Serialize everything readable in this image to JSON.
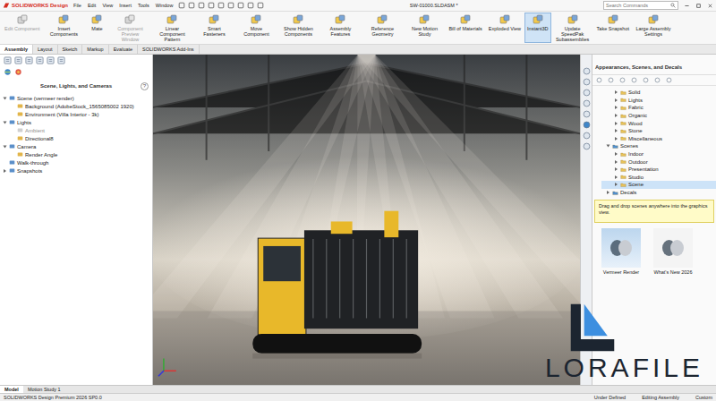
{
  "title_bar": {
    "logo": "SOLIDWORKS Design",
    "menus": [
      "File",
      "Edit",
      "View",
      "Insert",
      "Tools",
      "Window"
    ],
    "document": "SW-01000.SLDASM *",
    "search_placeholder": "Search Commands"
  },
  "ribbon": [
    {
      "label": "Edit Component",
      "disabled": true,
      "selected": false
    },
    {
      "label": "Insert Components",
      "disabled": false,
      "selected": false
    },
    {
      "label": "Mate",
      "disabled": false,
      "selected": false
    },
    {
      "label": "Component Preview Window",
      "disabled": true,
      "selected": false
    },
    {
      "label": "Linear Component Pattern",
      "disabled": false,
      "selected": false
    },
    {
      "label": "Smart Fasteners",
      "disabled": false,
      "selected": false
    },
    {
      "label": "Move Component",
      "disabled": false,
      "selected": false
    },
    {
      "label": "Show Hidden Components",
      "disabled": false,
      "selected": false
    },
    {
      "label": "Assembly Features",
      "disabled": false,
      "selected": false
    },
    {
      "label": "Reference Geometry",
      "disabled": false,
      "selected": false
    },
    {
      "label": "New Motion Study",
      "disabled": false,
      "selected": false
    },
    {
      "label": "Bill of Materials",
      "disabled": false,
      "selected": false
    },
    {
      "label": "Exploded View",
      "disabled": false,
      "selected": false
    },
    {
      "label": "Instant3D",
      "disabled": false,
      "selected": true
    },
    {
      "label": "Update SpeedPak Subassemblies",
      "disabled": false,
      "selected": false
    },
    {
      "label": "Take Snapshot",
      "disabled": false,
      "selected": false
    },
    {
      "label": "Large Assembly Settings",
      "disabled": false,
      "selected": false
    }
  ],
  "command_tabs": [
    {
      "label": "Assembly",
      "selected": true
    },
    {
      "label": "Layout",
      "selected": false
    },
    {
      "label": "Sketch",
      "selected": false
    },
    {
      "label": "Markup",
      "selected": false
    },
    {
      "label": "Evaluate",
      "selected": false
    },
    {
      "label": "SOLIDWORKS Add-Ins",
      "selected": false
    }
  ],
  "left_panel": {
    "title": "Scene, Lights, and Cameras",
    "help": "?",
    "tree": [
      {
        "label": "Scene (vermeer render)",
        "depth": 0,
        "leaf": false,
        "expanded": true,
        "disabled": false
      },
      {
        "label": "Background (AdobeStock_1565085002 1920)",
        "depth": 1,
        "leaf": true,
        "expanded": false,
        "disabled": false
      },
      {
        "label": "Environment (Villa Interior - 3k)",
        "depth": 1,
        "leaf": true,
        "expanded": false,
        "disabled": false
      },
      {
        "label": "Lights",
        "depth": 0,
        "leaf": false,
        "expanded": true,
        "disabled": false
      },
      {
        "label": "Ambient",
        "depth": 1,
        "leaf": true,
        "expanded": false,
        "disabled": true
      },
      {
        "label": "Directional8",
        "depth": 1,
        "leaf": true,
        "expanded": false,
        "disabled": false
      },
      {
        "label": "Camera",
        "depth": 0,
        "leaf": false,
        "expanded": true,
        "disabled": false
      },
      {
        "label": "Render Angle",
        "depth": 1,
        "leaf": true,
        "expanded": false,
        "disabled": false
      },
      {
        "label": "Walk-through",
        "depth": 0,
        "leaf": true,
        "expanded": false,
        "disabled": false
      },
      {
        "label": "Snapshots",
        "depth": 0,
        "leaf": false,
        "expanded": false,
        "disabled": false
      }
    ]
  },
  "right_panel": {
    "title": "Appearances, Scenes, and Decals",
    "tree": [
      {
        "label": "Solid",
        "depth": 1,
        "expanded": false,
        "selected": false
      },
      {
        "label": "Lights",
        "depth": 1,
        "expanded": false,
        "selected": false
      },
      {
        "label": "Fabric",
        "depth": 1,
        "expanded": false,
        "selected": false
      },
      {
        "label": "Organic",
        "depth": 1,
        "expanded": false,
        "selected": false
      },
      {
        "label": "Wood",
        "depth": 1,
        "expanded": false,
        "selected": false
      },
      {
        "label": "Stone",
        "depth": 1,
        "expanded": false,
        "selected": false
      },
      {
        "label": "Miscellaneous",
        "depth": 1,
        "expanded": false,
        "selected": false
      },
      {
        "label": "Scenes",
        "depth": 0,
        "expanded": true,
        "selected": false
      },
      {
        "label": "Indoor",
        "depth": 1,
        "expanded": false,
        "selected": false
      },
      {
        "label": "Outdoor",
        "depth": 1,
        "expanded": false,
        "selected": false
      },
      {
        "label": "Presentation",
        "depth": 1,
        "expanded": false,
        "selected": false
      },
      {
        "label": "Studio",
        "depth": 1,
        "expanded": false,
        "selected": false
      },
      {
        "label": "Scene",
        "depth": 1,
        "expanded": false,
        "selected": true
      },
      {
        "label": "Decals",
        "depth": 0,
        "expanded": false,
        "selected": false
      }
    ],
    "tip": "Drag and drop scenes anywhere into the graphics view.",
    "thumbnails": [
      {
        "label": "Vermeer Render"
      },
      {
        "label": "What's New 2026"
      }
    ]
  },
  "bottom_tabs": [
    {
      "label": "Model",
      "selected": true
    },
    {
      "label": "Motion Study 1",
      "selected": false
    }
  ],
  "status_bar": {
    "left": "SOLIDWORKS Design Premium 2026 SP0.0",
    "right": [
      "Under Defined",
      "Editing Assembly",
      "Custom"
    ]
  },
  "watermark": "LORAFILE"
}
